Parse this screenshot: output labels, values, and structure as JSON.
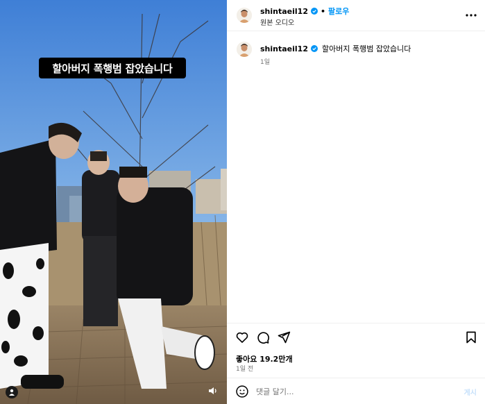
{
  "media": {
    "caption": "할아버지 폭행범 잡았습니다"
  },
  "post": {
    "username": "shintaeil12",
    "follow_label": "팔로우",
    "dot": "•",
    "audio_label": "원본 오디오",
    "comment": {
      "username": "shintaeil12",
      "text": "할아버지 폭행범 잡았습니다",
      "age": "1일"
    },
    "likes": "좋아요 19.2만개",
    "posted": "1일 전",
    "comment_placeholder": "댓글 달기...",
    "post_label": "게시"
  },
  "icons": {
    "more": "more-icon",
    "like": "heart-icon",
    "comment": "comment-icon",
    "share": "share-icon",
    "save": "bookmark-icon",
    "emoji": "emoji-icon",
    "verified": "verified-icon",
    "user": "user-icon",
    "audio": "audio-icon"
  },
  "colors": {
    "accent": "#0095f6",
    "verified": "#0095f6",
    "caption_bg": "#000000",
    "muted": "#737373"
  }
}
